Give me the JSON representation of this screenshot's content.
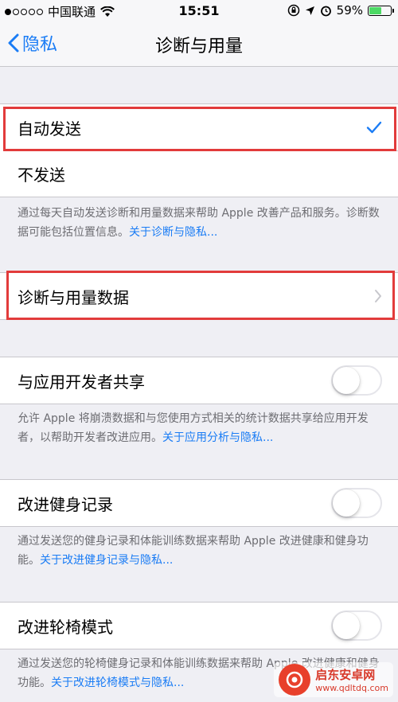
{
  "status_bar": {
    "carrier": "中国联通",
    "time": "15:51",
    "battery": "59%",
    "battery_level": 0.59
  },
  "nav": {
    "back_label": "隐私",
    "title": "诊断与用量"
  },
  "send_group": {
    "auto_send": "自动发送",
    "dont_send": "不发送"
  },
  "send_footer": {
    "text": "通过每天自动发送诊断和用量数据来帮助 Apple 改善产品和服务。诊断数据可能包括位置信息。",
    "link": "关于诊断与隐私..."
  },
  "data_group": {
    "label": "诊断与用量数据"
  },
  "share_group": {
    "label": "与应用开发者共享",
    "enabled": false
  },
  "share_footer": {
    "text": "允许 Apple 将崩溃数据和与您使用方式相关的统计数据共享给应用开发者，以帮助开发者改进应用。",
    "link": "关于应用分析与隐私..."
  },
  "fitness_group": {
    "label": "改进健身记录",
    "enabled": false
  },
  "fitness_footer": {
    "text": "通过发送您的健身记录和体能训练数据来帮助 Apple 改进健康和健身功能。",
    "link": "关于改进健身记录与隐私..."
  },
  "wheelchair_group": {
    "label": "改进轮椅模式",
    "enabled": false
  },
  "wheelchair_footer": {
    "text": "通过发送您的轮椅健身记录和体能训练数据来帮助 Apple 改进健康和健身功能。",
    "link": "关于改进轮椅模式与隐私..."
  },
  "watermark": {
    "title": "启东安卓网",
    "url": "www.qdltdq.com"
  },
  "colors": {
    "accent": "#1a7cf5",
    "highlight": "#e23b3b",
    "background": "#efeff4"
  }
}
